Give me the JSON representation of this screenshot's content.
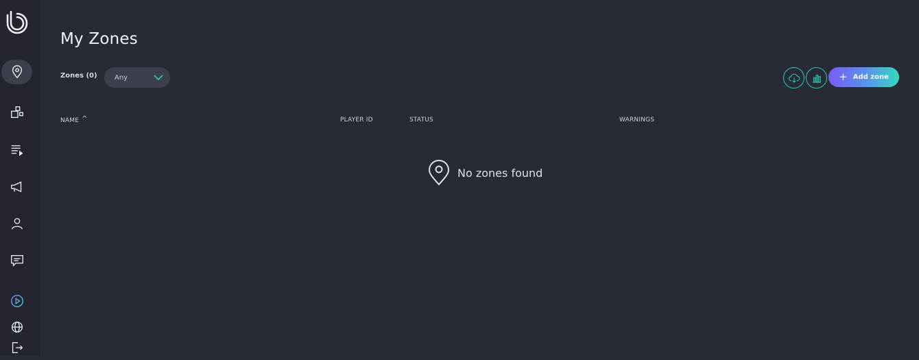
{
  "page": {
    "title": "My Zones"
  },
  "filters": {
    "zones_label": "Zones (0)",
    "status_value": "Any"
  },
  "actions": {
    "add_zone_label": "Add zone"
  },
  "table": {
    "columns": [
      "NAME",
      "PLAYER ID",
      "STATUS",
      "WARNINGS"
    ],
    "sorted_column": "NAME",
    "sort_direction": "ascending",
    "sort_indicator": "^"
  },
  "empty_state": {
    "text": "No zones found"
  },
  "sidebar": {
    "items": [
      {
        "name": "zones",
        "icon": "map-pin-icon",
        "active": true
      },
      {
        "name": "content",
        "icon": "shapes-icon",
        "active": false
      },
      {
        "name": "playlists",
        "icon": "playlist-icon",
        "active": false
      },
      {
        "name": "announcements",
        "icon": "megaphone-icon",
        "active": false
      },
      {
        "name": "account",
        "icon": "user-icon",
        "active": false
      },
      {
        "name": "messages",
        "icon": "chat-icon",
        "active": false
      },
      {
        "name": "player",
        "icon": "play-circle-icon",
        "active": false
      },
      {
        "name": "language",
        "icon": "globe-icon",
        "active": false
      },
      {
        "name": "logout",
        "icon": "logout-icon",
        "active": false
      }
    ]
  },
  "colors": {
    "background": "#272b35",
    "sidebar": "#23262f",
    "accent_teal": "#2fc6b0",
    "accent_purple": "#7a5cf0"
  }
}
